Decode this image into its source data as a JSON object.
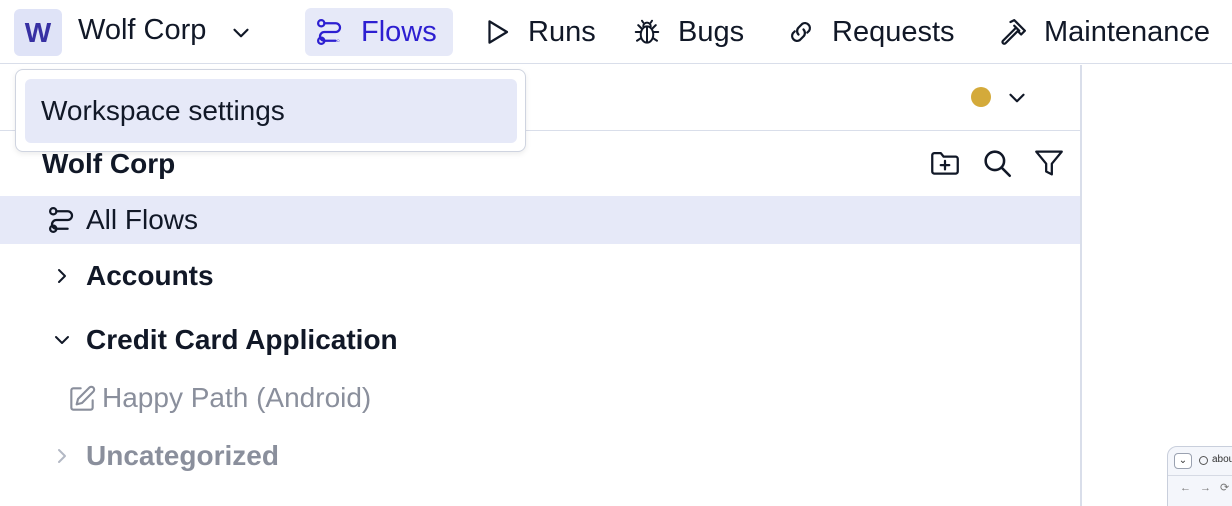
{
  "workspace": {
    "avatar_letter": "W",
    "name": "Wolf Corp"
  },
  "nav": {
    "tabs": [
      {
        "label": "Flows",
        "icon": "flows-icon",
        "active": true
      },
      {
        "label": "Runs",
        "icon": "play-icon",
        "active": false
      },
      {
        "label": "Bugs",
        "icon": "bug-icon",
        "active": false
      },
      {
        "label": "Requests",
        "icon": "link-icon",
        "active": false
      },
      {
        "label": "Maintenance",
        "icon": "hammer-icon",
        "active": false
      }
    ]
  },
  "dropdown": {
    "items": [
      {
        "label": "Workspace settings"
      }
    ]
  },
  "sidebar": {
    "title": "Wolf Corp",
    "all_flows_label": "All Flows",
    "status_color": "#d4aa3a",
    "folders": [
      {
        "label": "Accounts",
        "expanded": false,
        "muted": false
      },
      {
        "label": "Credit Card Application",
        "expanded": true,
        "muted": false,
        "flows": [
          {
            "label": "Happy Path (Android)",
            "icon": "edit-icon"
          }
        ]
      },
      {
        "label": "Uncategorized",
        "expanded": false,
        "muted": true
      }
    ]
  },
  "preview": {
    "tab_glyph": "⌄",
    "url_text": "abou"
  },
  "colors": {
    "accent": "#2d1fd1",
    "active_bg": "#e6e9f8",
    "muted_text": "#8a8f9c"
  }
}
